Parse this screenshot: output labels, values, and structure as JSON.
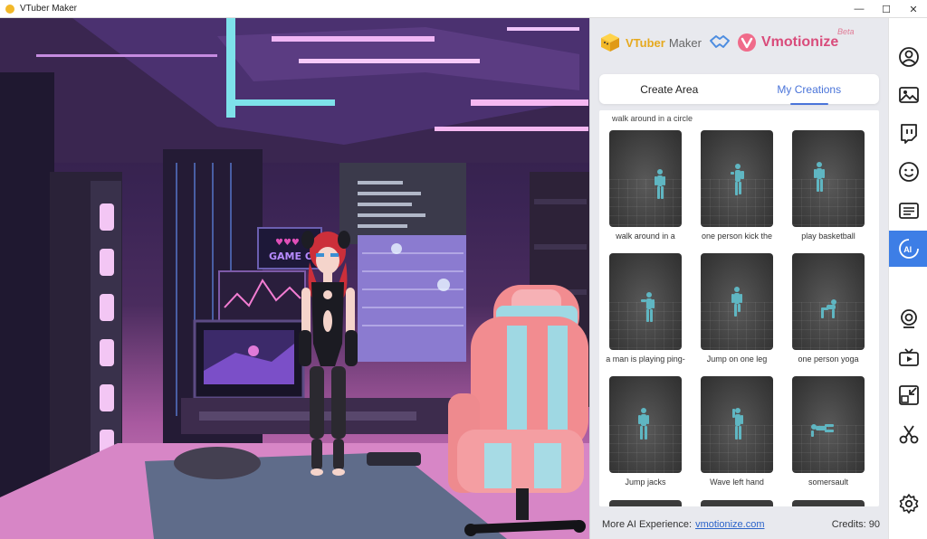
{
  "window": {
    "title": "VTuber Maker",
    "controls": [
      "—",
      "☐",
      "✕"
    ]
  },
  "scene": {
    "sign_text": "GAME O"
  },
  "panel": {
    "brand": {
      "vtuber": "VTuber",
      "maker": "Maker",
      "vmotionize": "Vmotionize",
      "beta": "Beta"
    },
    "tabs": [
      {
        "label": "Create Area",
        "active": false
      },
      {
        "label": "My Creations",
        "active": true
      }
    ],
    "section_title": "walk around in a circle",
    "cards": [
      {
        "label": "walk around in a"
      },
      {
        "label": "one person kick the"
      },
      {
        "label": "play basketball"
      },
      {
        "label": "a man is playing ping-"
      },
      {
        "label": "Jump on one leg"
      },
      {
        "label": "one person yoga"
      },
      {
        "label": "Jump jacks"
      },
      {
        "label": "Wave left hand"
      },
      {
        "label": "somersault"
      }
    ],
    "footer": {
      "label": "More AI Experience:",
      "link": "vmotionize.com",
      "credits": "Credits: 90"
    }
  },
  "toolbar": {
    "items": [
      {
        "icon": "avatar-icon",
        "active": false
      },
      {
        "icon": "image-icon",
        "active": false
      },
      {
        "icon": "twitch-icon",
        "active": false
      },
      {
        "icon": "face-icon",
        "active": false
      },
      {
        "icon": "text-panel-icon",
        "active": false
      },
      {
        "icon": "ai-icon",
        "active": true,
        "text": "AI"
      },
      {
        "icon": "webcam-icon",
        "active": false
      },
      {
        "icon": "tv-icon",
        "active": false
      },
      {
        "icon": "shrink-icon",
        "active": false
      },
      {
        "icon": "scissors-icon",
        "active": false
      },
      {
        "icon": "settings-icon",
        "active": false
      }
    ]
  },
  "colors": {
    "accent": "#3d7ee6",
    "tab_active": "#4a74d9",
    "vmotionize": "#d94c7b",
    "vtuber": "#e6a91e",
    "link": "#2b63c9"
  }
}
